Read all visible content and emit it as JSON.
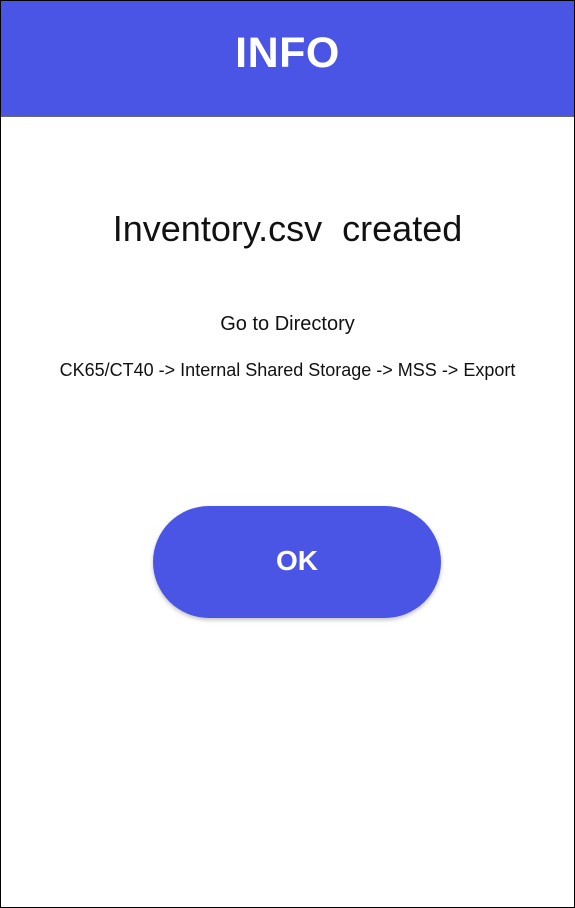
{
  "colors": {
    "accent": "#4a55e6",
    "background": "#ffffff",
    "text": "#111111"
  },
  "header": {
    "title": "INFO"
  },
  "dialog": {
    "message": "Inventory.csv  created",
    "directory_label": "Go to Directory",
    "directory_path": "CK65/CT40 -> Internal Shared Storage -> MSS -> Export",
    "ok_label": "OK"
  }
}
